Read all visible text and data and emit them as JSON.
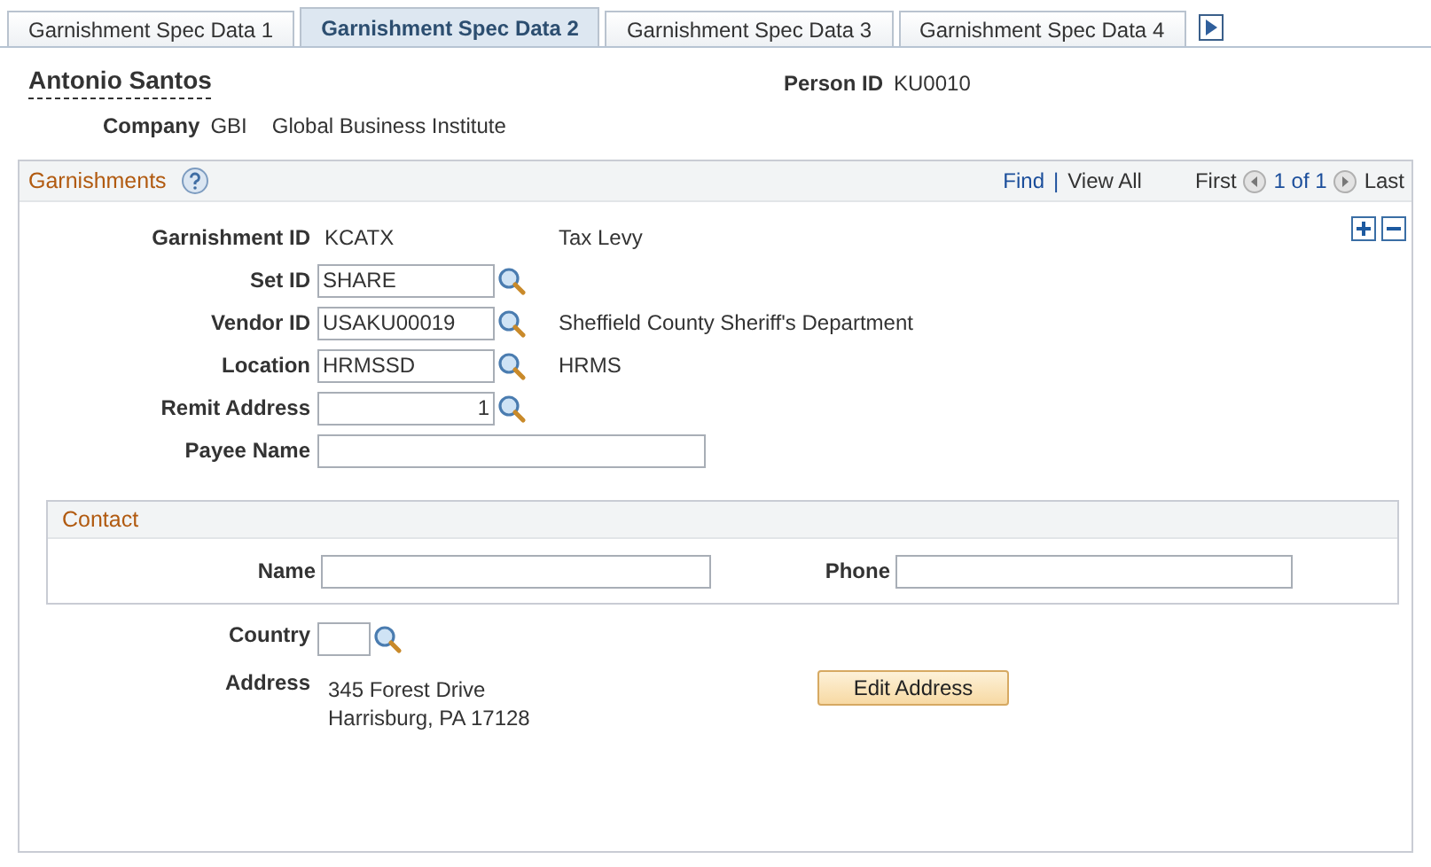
{
  "tabs": [
    {
      "label": "Garnishment Spec Data 1",
      "selected": false
    },
    {
      "label": "Garnishment Spec Data 2",
      "selected": true
    },
    {
      "label": "Garnishment Spec Data 3",
      "selected": false
    },
    {
      "label": "Garnishment Spec Data 4",
      "selected": false
    }
  ],
  "person": {
    "name": "Antonio Santos",
    "person_id_label": "Person ID",
    "person_id": "KU0010",
    "company_label": "Company",
    "company_code": "GBI",
    "company_name": "Global Business Institute"
  },
  "garnishments": {
    "title": "Garnishments",
    "find": "Find",
    "separator": "|",
    "view_all": "View All",
    "first": "First",
    "page": "1 of 1",
    "last": "Last",
    "fields": [
      {
        "kind": "display",
        "label": "Garnishment ID",
        "value": "KCATX",
        "description": "Tax Levy"
      },
      {
        "kind": "input",
        "label": "Set ID",
        "value": "SHARE",
        "lookup": true
      },
      {
        "kind": "input",
        "label": "Vendor ID",
        "value": "USAKU00019",
        "lookup": true,
        "description": "Sheffield County Sheriff's Department"
      },
      {
        "kind": "input",
        "label": "Location",
        "value": "HRMSSD",
        "lookup": true,
        "description": "HRMS"
      },
      {
        "kind": "number",
        "label": "Remit Address",
        "value": "1",
        "lookup": true
      },
      {
        "kind": "wide",
        "label": "Payee Name",
        "lookup": false
      }
    ],
    "contact": {
      "title": "Contact",
      "name_label": "Name",
      "phone_label": "Phone"
    },
    "country_label": "Country",
    "address_label": "Address",
    "address_lines": [
      "345 Forest Drive",
      "Harrisburg, PA 17128"
    ],
    "edit_button": "Edit Address"
  }
}
